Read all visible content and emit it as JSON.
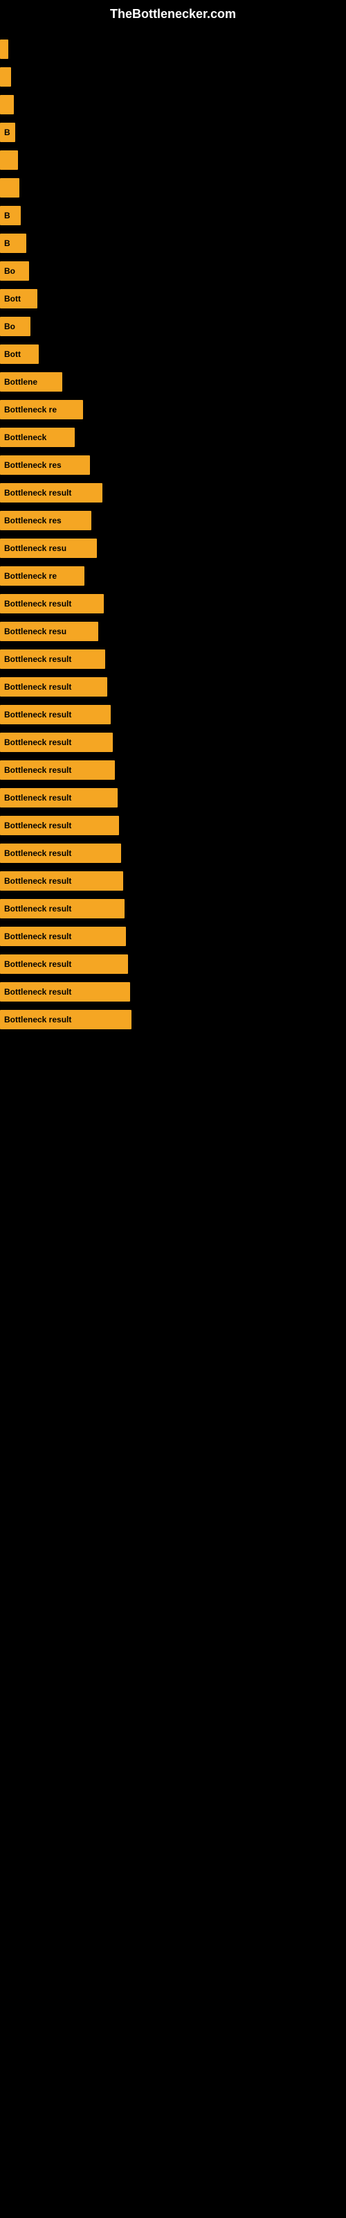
{
  "header": {
    "title": "TheBottlenecker.com"
  },
  "bars": [
    {
      "label": "",
      "width": 12
    },
    {
      "label": "",
      "width": 16
    },
    {
      "label": "",
      "width": 20
    },
    {
      "label": "B",
      "width": 22
    },
    {
      "label": "",
      "width": 26
    },
    {
      "label": "",
      "width": 28
    },
    {
      "label": "B",
      "width": 30
    },
    {
      "label": "B",
      "width": 38
    },
    {
      "label": "Bo",
      "width": 42
    },
    {
      "label": "Bott",
      "width": 54
    },
    {
      "label": "Bo",
      "width": 44
    },
    {
      "label": "Bott",
      "width": 56
    },
    {
      "label": "Bottlene",
      "width": 90
    },
    {
      "label": "Bottleneck re",
      "width": 120
    },
    {
      "label": "Bottleneck",
      "width": 108
    },
    {
      "label": "Bottleneck res",
      "width": 130
    },
    {
      "label": "Bottleneck result",
      "width": 148
    },
    {
      "label": "Bottleneck res",
      "width": 132
    },
    {
      "label": "Bottleneck resu",
      "width": 140
    },
    {
      "label": "Bottleneck re",
      "width": 122
    },
    {
      "label": "Bottleneck result",
      "width": 150
    },
    {
      "label": "Bottleneck resu",
      "width": 142
    },
    {
      "label": "Bottleneck result",
      "width": 152
    },
    {
      "label": "Bottleneck result",
      "width": 155
    },
    {
      "label": "Bottleneck result",
      "width": 160
    },
    {
      "label": "Bottleneck result",
      "width": 163
    },
    {
      "label": "Bottleneck result",
      "width": 166
    },
    {
      "label": "Bottleneck result",
      "width": 170
    },
    {
      "label": "Bottleneck result",
      "width": 172
    },
    {
      "label": "Bottleneck result",
      "width": 175
    },
    {
      "label": "Bottleneck result",
      "width": 178
    },
    {
      "label": "Bottleneck result",
      "width": 180
    },
    {
      "label": "Bottleneck result",
      "width": 182
    },
    {
      "label": "Bottleneck result",
      "width": 185
    },
    {
      "label": "Bottleneck result",
      "width": 188
    },
    {
      "label": "Bottleneck result",
      "width": 190
    }
  ]
}
